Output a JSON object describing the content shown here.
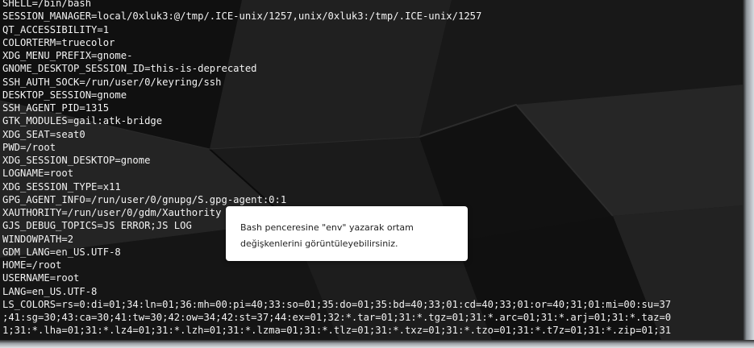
{
  "terminal": {
    "lines": [
      "SHELL=/bin/bash",
      "SESSION_MANAGER=local/0xluk3:@/tmp/.ICE-unix/1257,unix/0xluk3:/tmp/.ICE-unix/1257",
      "QT_ACCESSIBILITY=1",
      "COLORTERM=truecolor",
      "XDG_MENU_PREFIX=gnome-",
      "GNOME_DESKTOP_SESSION_ID=this-is-deprecated",
      "SSH_AUTH_SOCK=/run/user/0/keyring/ssh",
      "DESKTOP_SESSION=gnome",
      "SSH_AGENT_PID=1315",
      "GTK_MODULES=gail:atk-bridge",
      "XDG_SEAT=seat0",
      "PWD=/root",
      "XDG_SESSION_DESKTOP=gnome",
      "LOGNAME=root",
      "XDG_SESSION_TYPE=x11",
      "GPG_AGENT_INFO=/run/user/0/gnupg/S.gpg-agent:0:1",
      "XAUTHORITY=/run/user/0/gdm/Xauthority",
      "GJS_DEBUG_TOPICS=JS ERROR;JS LOG",
      "WINDOWPATH=2",
      "GDM_LANG=en_US.UTF-8",
      "HOME=/root",
      "USERNAME=root",
      "LANG=en_US.UTF-8",
      "LS_COLORS=rs=0:di=01;34:ln=01;36:mh=00:pi=40;33:so=01;35:do=01;35:bd=40;33;01:cd=40;33;01:or=40;31;01:mi=00:su=37",
      ";41:sg=30;43:ca=30;41:tw=30;42:ow=34;42:st=37;44:ex=01;32:*.tar=01;31:*.tgz=01;31:*.arc=01;31:*.arj=01;31:*.taz=0",
      "1;31:*.lha=01;31:*.lz4=01;31:*.lzh=01;31:*.lzma=01;31:*.tlz=01;31:*.txz=01;31:*.tzo=01;31:*.t7z=01;31:*.zip=01;31"
    ]
  },
  "tooltip": {
    "line1": "Bash penceresine \"env\" yazarak ortam",
    "line2": "değişkenlerini görüntüleyebilirsiniz."
  },
  "colors": {
    "terminal_text": "#f2f2f2",
    "terminal_background": "#121212",
    "tooltip_background": "#ffffff",
    "tooltip_text": "#222222"
  }
}
